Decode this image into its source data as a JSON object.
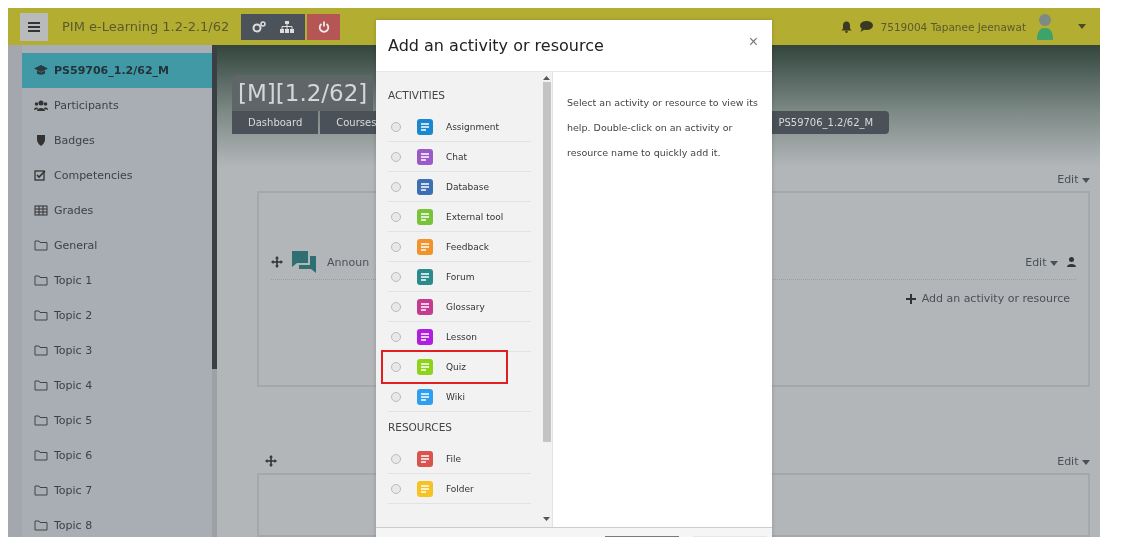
{
  "header": {
    "site_name": "PIM e-Learning 1.2-2.1/62",
    "user_name": "7519004 Tapanee Jeenawat"
  },
  "sidebar": {
    "items": [
      {
        "label": "PS59706_1.2/62_M",
        "kind": "course",
        "selected": true
      },
      {
        "label": "Participants",
        "kind": "participants",
        "selected": false
      },
      {
        "label": "Badges",
        "kind": "badges",
        "selected": false
      },
      {
        "label": "Competencies",
        "kind": "competencies",
        "selected": false
      },
      {
        "label": "Grades",
        "kind": "grades",
        "selected": false
      },
      {
        "label": "General",
        "kind": "folder",
        "selected": false
      },
      {
        "label": "Topic 1",
        "kind": "folder",
        "selected": false
      },
      {
        "label": "Topic 2",
        "kind": "folder",
        "selected": false
      },
      {
        "label": "Topic 3",
        "kind": "folder",
        "selected": false
      },
      {
        "label": "Topic 4",
        "kind": "folder",
        "selected": false
      },
      {
        "label": "Topic 5",
        "kind": "folder",
        "selected": false
      },
      {
        "label": "Topic 6",
        "kind": "folder",
        "selected": false
      },
      {
        "label": "Topic 7",
        "kind": "folder",
        "selected": false
      },
      {
        "label": "Topic 8",
        "kind": "folder",
        "selected": false
      }
    ]
  },
  "course": {
    "title": "[M][1.2/62]",
    "breadcrumb": [
      "Dashboard",
      "Courses",
      "PS59706_1.2/62_M"
    ]
  },
  "sections": [
    {
      "edit": "Edit",
      "activities": [
        {
          "name": "Announ",
          "edit": "Edit"
        }
      ],
      "add_label": "Add an activity or resource"
    },
    {
      "edit": "Edit"
    }
  ],
  "dialog": {
    "title": "Add an activity or resource",
    "close": "×",
    "help": "Select an activity or resource to view its help. Double-click on an activity or resource name to quickly add it.",
    "groups": [
      {
        "heading": "ACTIVITIES",
        "items": [
          {
            "label": "Assignment",
            "color": "#1b87d0",
            "selected": false,
            "highlighted": false
          },
          {
            "label": "Chat",
            "color": "#9b59c9",
            "selected": false,
            "highlighted": false
          },
          {
            "label": "Database",
            "color": "#3c6fb4",
            "selected": false,
            "highlighted": false
          },
          {
            "label": "External tool",
            "color": "#79c33a",
            "selected": false,
            "highlighted": false
          },
          {
            "label": "Feedback",
            "color": "#f0932b",
            "selected": false,
            "highlighted": false
          },
          {
            "label": "Forum",
            "color": "#2b8a8c",
            "selected": false,
            "highlighted": false
          },
          {
            "label": "Glossary",
            "color": "#c43b8f",
            "selected": false,
            "highlighted": false
          },
          {
            "label": "Lesson",
            "color": "#b01fe0",
            "selected": false,
            "highlighted": false
          },
          {
            "label": "Quiz",
            "color": "#8ed21b",
            "selected": false,
            "highlighted": true
          },
          {
            "label": "Wiki",
            "color": "#2f9ef0",
            "selected": false,
            "highlighted": false
          }
        ]
      },
      {
        "heading": "RESOURCES",
        "items": [
          {
            "label": "File",
            "color": "#d9534f",
            "selected": false,
            "highlighted": false
          },
          {
            "label": "Folder",
            "color": "#f6c224",
            "selected": false,
            "highlighted": false
          }
        ]
      }
    ]
  }
}
